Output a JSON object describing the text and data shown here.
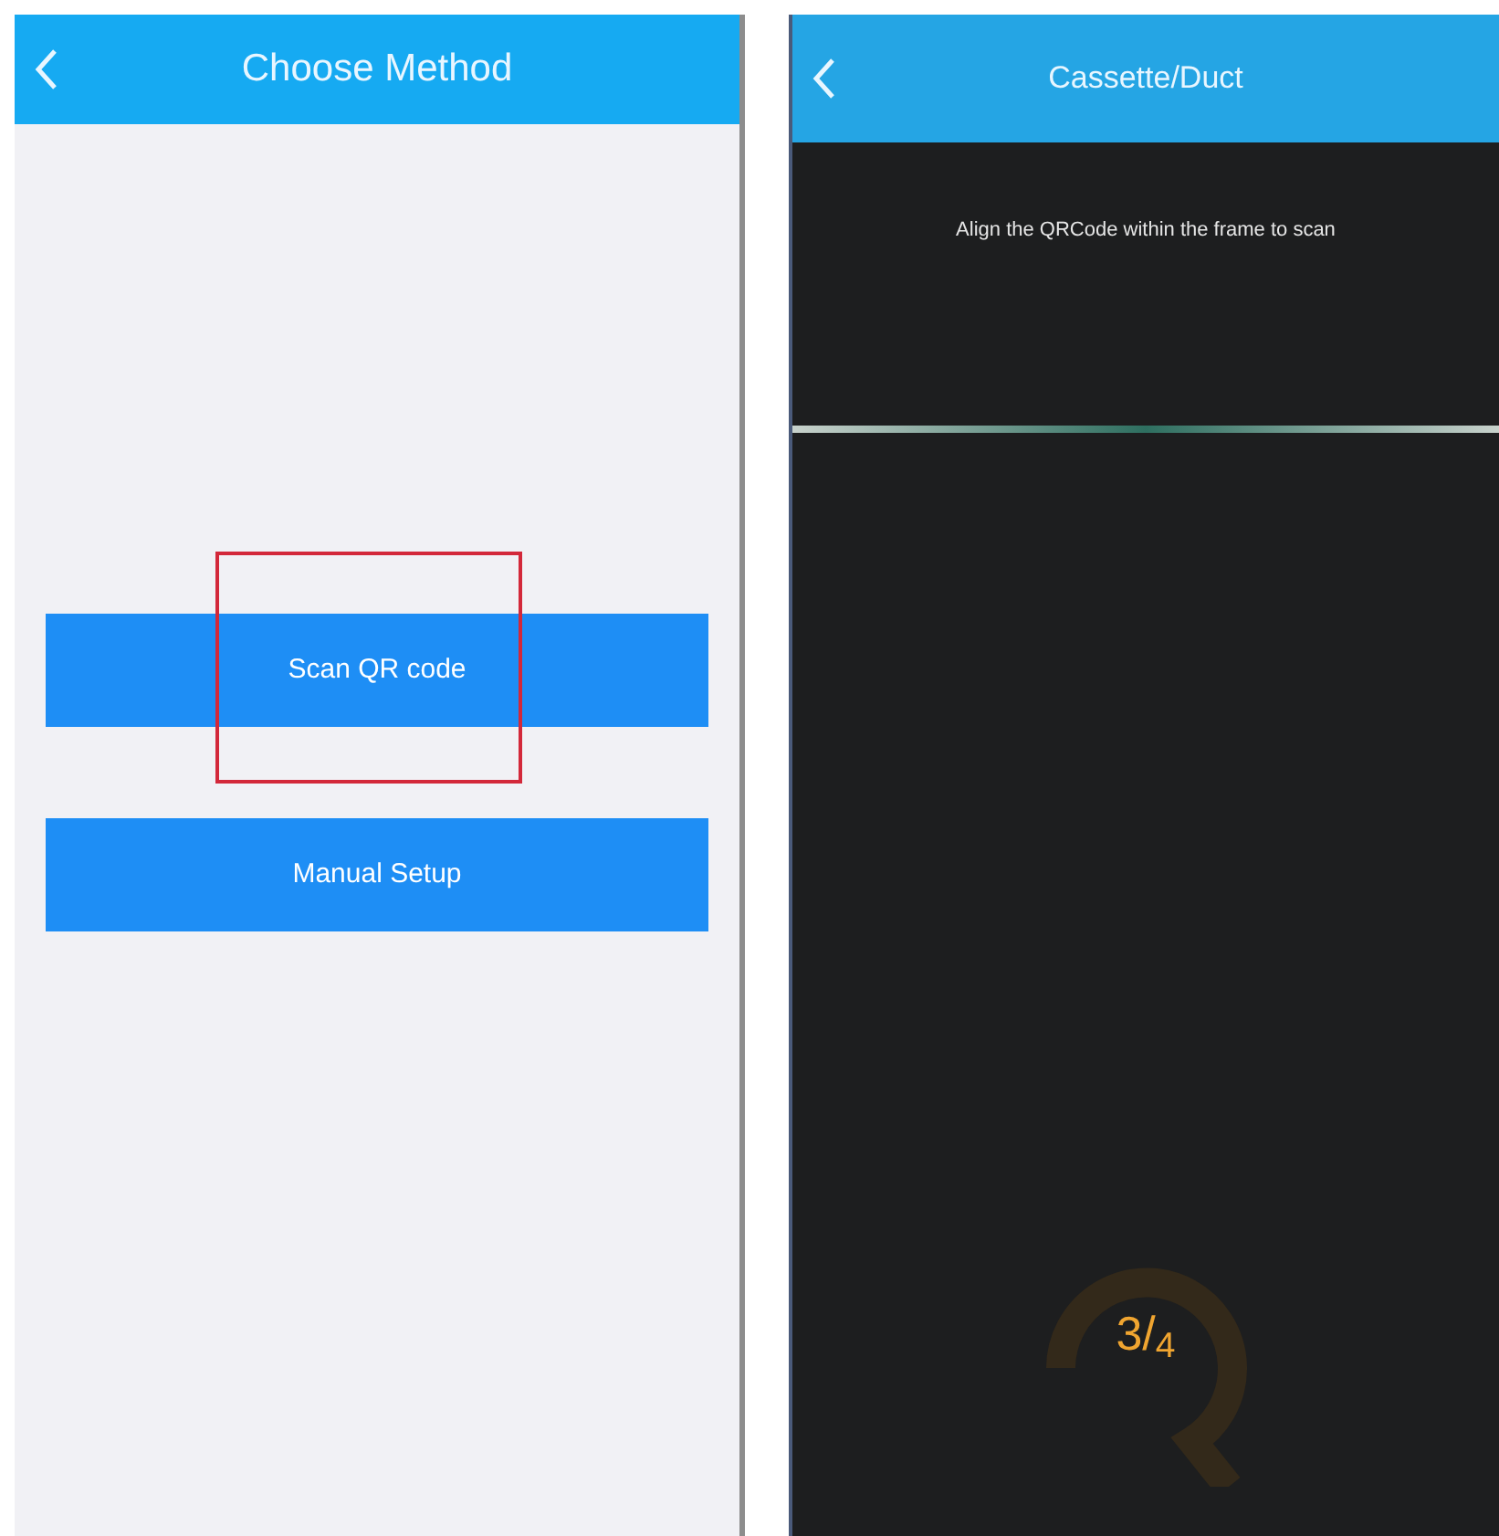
{
  "left_screen": {
    "title": "Choose Method",
    "buttons": [
      {
        "label": "Scan QR code",
        "highlighted": true
      },
      {
        "label": "Manual Setup",
        "highlighted": false
      }
    ]
  },
  "right_screen": {
    "title": "Cassette/Duct",
    "instruction": "Align the QRCode within the frame to scan",
    "step_indicator": "3/$_{4}$"
  }
}
